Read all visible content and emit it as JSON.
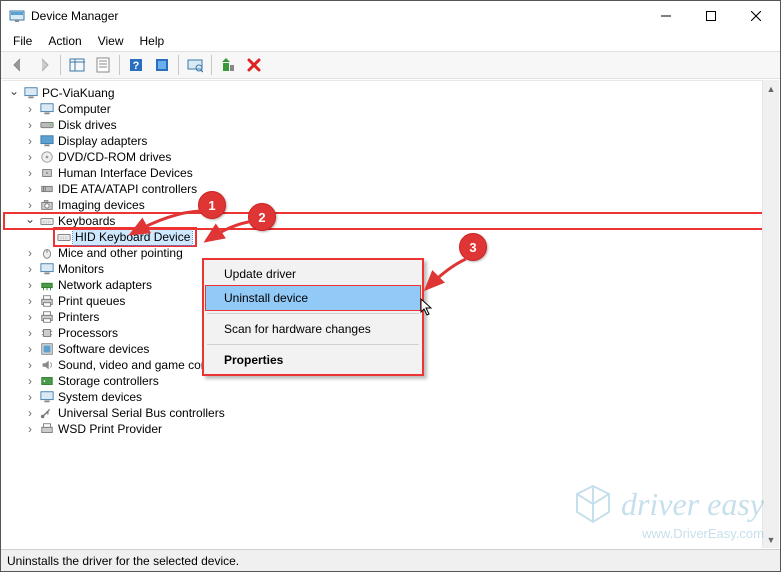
{
  "window": {
    "title": "Device Manager"
  },
  "menu": {
    "file": "File",
    "action": "Action",
    "view": "View",
    "help": "Help"
  },
  "tree": {
    "root": "PC-ViaKuang",
    "items": [
      "Computer",
      "Disk drives",
      "Display adapters",
      "DVD/CD-ROM drives",
      "Human Interface Devices",
      "IDE ATA/ATAPI controllers",
      "Imaging devices",
      "Keyboards",
      "Mice and other pointing",
      "Monitors",
      "Network adapters",
      "Print queues",
      "Printers",
      "Processors",
      "Software devices",
      "Sound, video and game controllers",
      "Storage controllers",
      "System devices",
      "Universal Serial Bus controllers",
      "WSD Print Provider"
    ],
    "keyboard_child": "HID Keyboard Device"
  },
  "context_menu": {
    "update": "Update driver",
    "uninstall": "Uninstall device",
    "scan": "Scan for hardware changes",
    "properties": "Properties"
  },
  "status": "Uninstalls the driver for the selected device.",
  "annotations": {
    "b1": "1",
    "b2": "2",
    "b3": "3"
  },
  "watermark": {
    "brand": "driver easy",
    "url": "www.DriverEasy.com"
  }
}
